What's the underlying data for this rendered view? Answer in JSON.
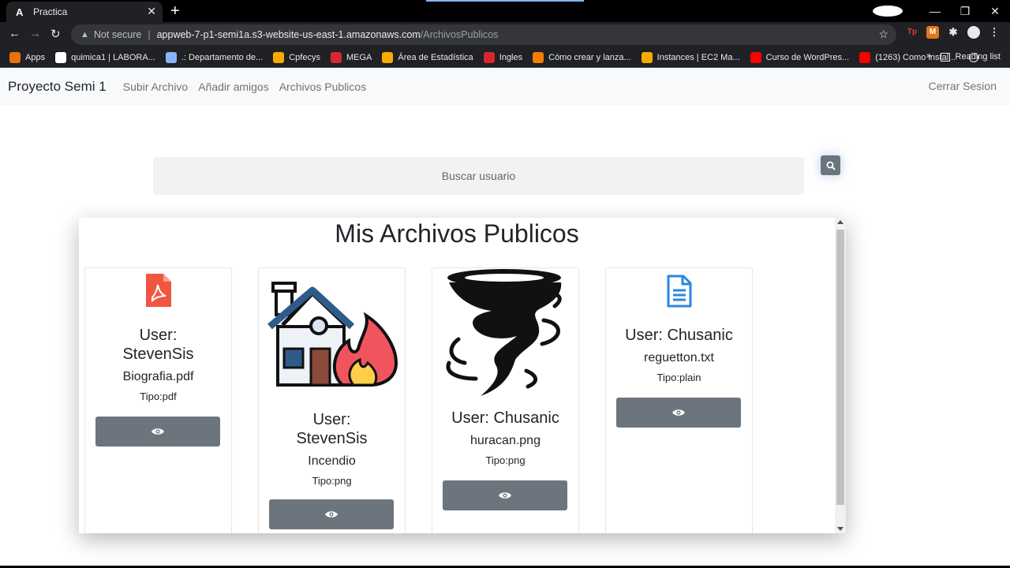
{
  "browser": {
    "tab_title": "Practica",
    "tab_favicon": "A",
    "address_security": "Not secure",
    "address_host": "appweb-7-p1-semi1a.s3-website-us-east-1.amazonaws.com",
    "address_path": "/ArchivosPublicos",
    "bookmarks": [
      {
        "label": "Apps",
        "icon": "apps-grid-icon",
        "color": "#e8710a"
      },
      {
        "label": "quimica1 | LABORA...",
        "icon": "wix-icon",
        "color": "#ffffff"
      },
      {
        "label": ".: Departamento de...",
        "icon": "department-icon",
        "color": "#8ab4f8"
      },
      {
        "label": "Cpfecys",
        "icon": "cpfecys-icon",
        "color": "#f9ab00"
      },
      {
        "label": "MEGA",
        "icon": "mega-icon",
        "color": "#d9272e"
      },
      {
        "label": "Área de Estadística",
        "icon": "stats-icon",
        "color": "#f9ab00"
      },
      {
        "label": "Ingles",
        "icon": "mega-icon",
        "color": "#d9272e"
      },
      {
        "label": "Cómo crear y lanza...",
        "icon": "box-icon",
        "color": "#f57c00"
      },
      {
        "label": "Instances | EC2 Ma...",
        "icon": "aws-icon",
        "color": "#f9ab00"
      },
      {
        "label": "Curso de WordPres...",
        "icon": "youtube-icon",
        "color": "#ff0000"
      },
      {
        "label": "(1263) Como instal...",
        "icon": "youtube-icon",
        "color": "#ff0000"
      }
    ],
    "reading_list": "Reading list"
  },
  "nav": {
    "brand": "Proyecto Semi 1",
    "links": [
      "Subir Archivo",
      "Añadir amigos",
      "Archivos Publicos"
    ],
    "logout": "Cerrar Sesion"
  },
  "search": {
    "placeholder": "Buscar usuario"
  },
  "panel": {
    "title": "Mis Archivos Publicos",
    "cards": [
      {
        "user_line1": "User:",
        "user_line2": "StevenSis",
        "file": "Biografia.pdf",
        "type": "Tipo:pdf",
        "icon": "pdf-file-icon"
      },
      {
        "user_line1": "User:",
        "user_line2": "StevenSis",
        "file": "Incendio",
        "type": "Tipo:png",
        "icon": "house-fire-image"
      },
      {
        "user_line1": "User: Chusanic",
        "user_line2": "",
        "file": "huracan.png",
        "type": "Tipo:png",
        "icon": "tornado-image"
      },
      {
        "user_line1": "User: Chusanic",
        "user_line2": "",
        "file": "reguetton.txt",
        "type": "Tipo:plain",
        "icon": "text-file-icon"
      }
    ]
  },
  "colors": {
    "button": "#6c757d",
    "pdf_red": "#f15642",
    "text_blue": "#2e86de"
  }
}
